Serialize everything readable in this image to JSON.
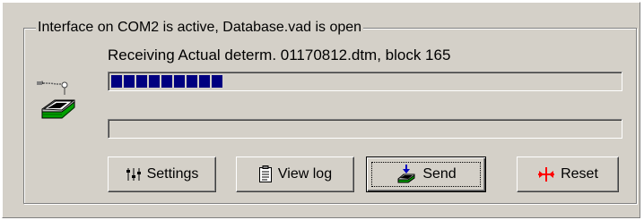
{
  "group": {
    "title": "Interface on COM2 is active, Database.vad is open"
  },
  "status": {
    "text": "Receiving Actual determ. 01170812.dtm, block 165"
  },
  "progress": {
    "primary_blocks_filled": 9,
    "secondary_fraction": 0
  },
  "buttons": {
    "settings_label": "Settings",
    "view_log_label": "View log",
    "send_label": "Send",
    "reset_label": "Reset"
  },
  "colors": {
    "progress_fill": "#000080",
    "dialog_face": "#d4d0c8",
    "reset_icon": "#ff0000"
  },
  "icons": {
    "device": "serial-device-icon",
    "settings": "settings-sliders-icon",
    "view_log": "log-document-icon",
    "send": "send-icon",
    "reset": "reset-icon"
  }
}
